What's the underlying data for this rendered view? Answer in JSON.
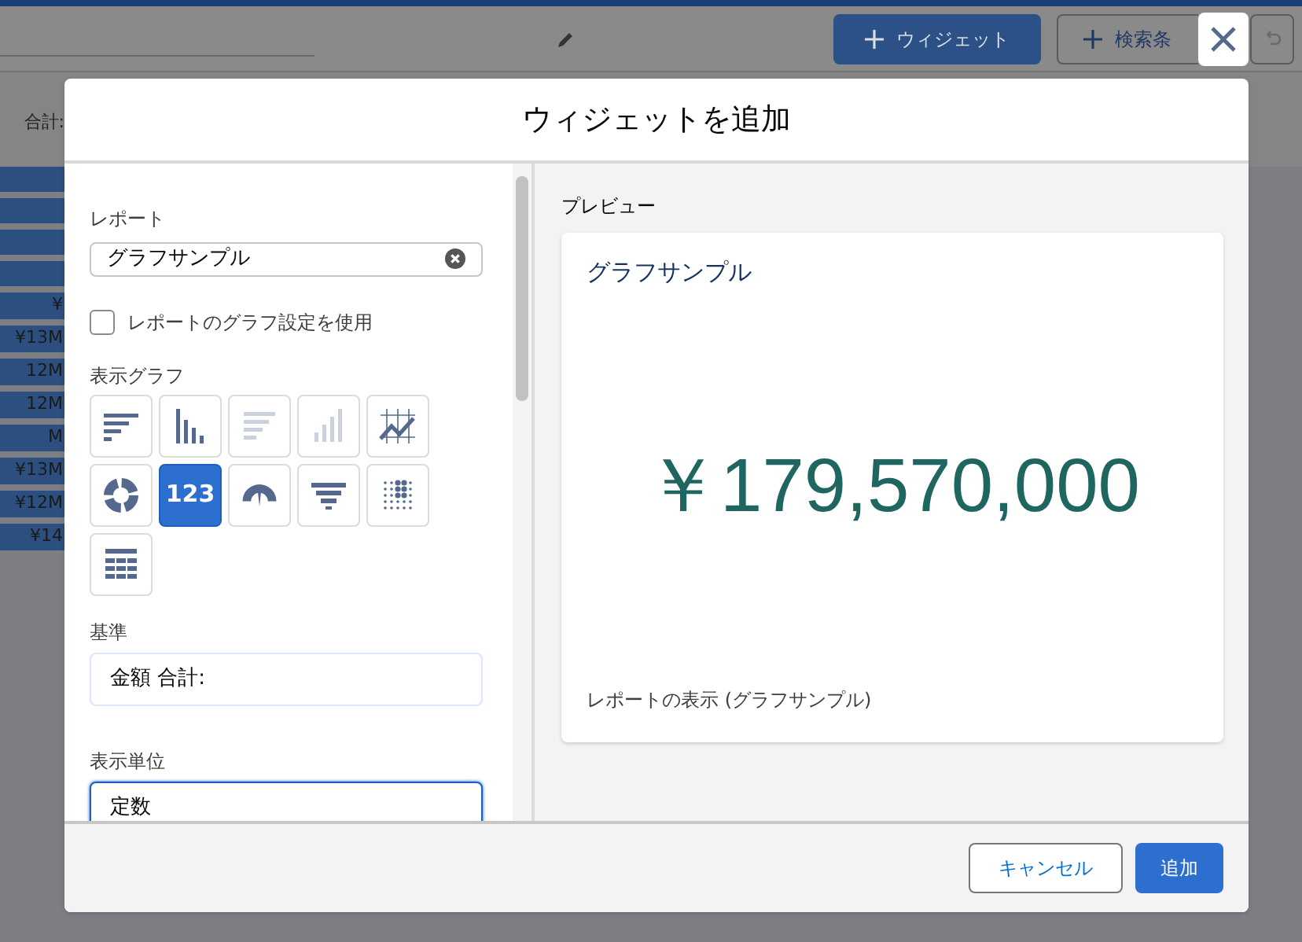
{
  "background": {
    "toolbar_buttons": [
      {
        "label": "ウィジェット",
        "kind": "primary"
      },
      {
        "label": "検索条",
        "kind": "outline"
      }
    ],
    "column_label": "合計:",
    "bar_labels": [
      "¥",
      "¥13M",
      "12M",
      "12M",
      "M",
      "¥13M",
      "¥12M",
      "¥14"
    ]
  },
  "modal": {
    "title": "ウィジェットを追加",
    "report": {
      "label": "レポート",
      "value": "グラフサンプル"
    },
    "use_report_chart": {
      "label": "レポートのグラフ設定を使用",
      "checked": false
    },
    "chart_types": {
      "label": "表示グラフ",
      "items": [
        {
          "kind": "hbar",
          "selected": false,
          "disabled": false
        },
        {
          "kind": "vbar",
          "selected": false,
          "disabled": false
        },
        {
          "kind": "hstack",
          "selected": false,
          "disabled": true
        },
        {
          "kind": "vstack",
          "selected": false,
          "disabled": true
        },
        {
          "kind": "line",
          "selected": false,
          "disabled": false
        },
        {
          "kind": "donut",
          "selected": false,
          "disabled": false
        },
        {
          "kind": "metric",
          "label": "123",
          "selected": true,
          "disabled": false
        },
        {
          "kind": "gauge",
          "selected": false,
          "disabled": false
        },
        {
          "kind": "funnel",
          "selected": false,
          "disabled": false
        },
        {
          "kind": "scatter",
          "selected": false,
          "disabled": false
        },
        {
          "kind": "table",
          "selected": false,
          "disabled": false
        }
      ]
    },
    "measure": {
      "label": "基準",
      "value": "金額 合計:"
    },
    "display_units": {
      "label": "表示単位",
      "value": "定数",
      "focused": true
    },
    "preview": {
      "label": "プレビュー",
      "card_title": "グラフサンプル",
      "metric": "￥179,570,000",
      "link": "レポートの表示 (グラフサンプル)"
    },
    "buttons": [
      {
        "label": "キャンセル",
        "kind": "neutral"
      },
      {
        "label": "追加",
        "kind": "brand"
      }
    ]
  }
}
